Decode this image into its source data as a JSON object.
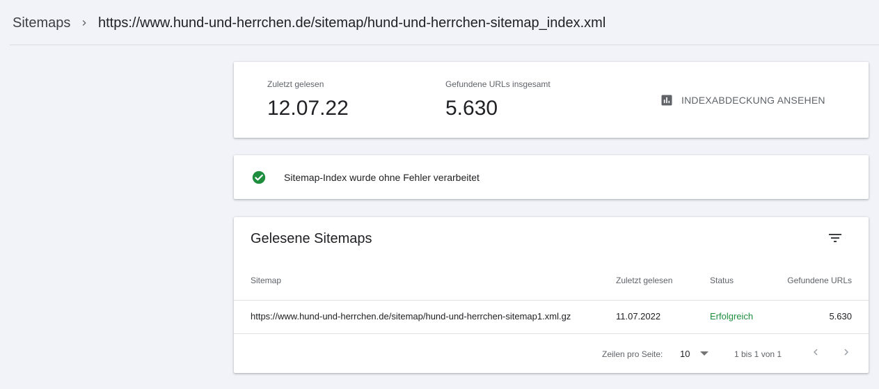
{
  "breadcrumb": {
    "root": "Sitemaps",
    "current": "https://www.hund-und-herrchen.de/sitemap/hund-und-herrchen-sitemap_index.xml"
  },
  "stats": {
    "last_read_label": "Zuletzt gelesen",
    "last_read_value": "12.07.22",
    "urls_label": "Gefundene URLs insgesamt",
    "urls_value": "5.630",
    "coverage_button": "INDEXABDECKUNG ANSEHEN"
  },
  "status": {
    "message": "Sitemap-Index wurde ohne Fehler verarbeitet"
  },
  "table": {
    "title": "Gelesene Sitemaps",
    "columns": {
      "sitemap": "Sitemap",
      "last_read": "Zuletzt gelesen",
      "status": "Status",
      "urls": "Gefundene URLs"
    },
    "rows": [
      {
        "sitemap": "https://www.hund-und-herrchen.de/sitemap/hund-und-herrchen-sitemap1.xml.gz",
        "last_read": "11.07.2022",
        "status": "Erfolgreich",
        "urls": "5.630"
      }
    ],
    "pagination": {
      "rows_per_page_label": "Zeilen pro Seite:",
      "rows_per_page_value": "10",
      "range": "1 bis 1 von 1"
    }
  },
  "colors": {
    "success": "#1e8e3e",
    "background": "#f1f3f9"
  },
  "icons": [
    "chevron-right-icon",
    "bar-chart-icon",
    "check-circle-icon",
    "filter-icon",
    "caret-down-icon",
    "chevron-left-icon"
  ]
}
